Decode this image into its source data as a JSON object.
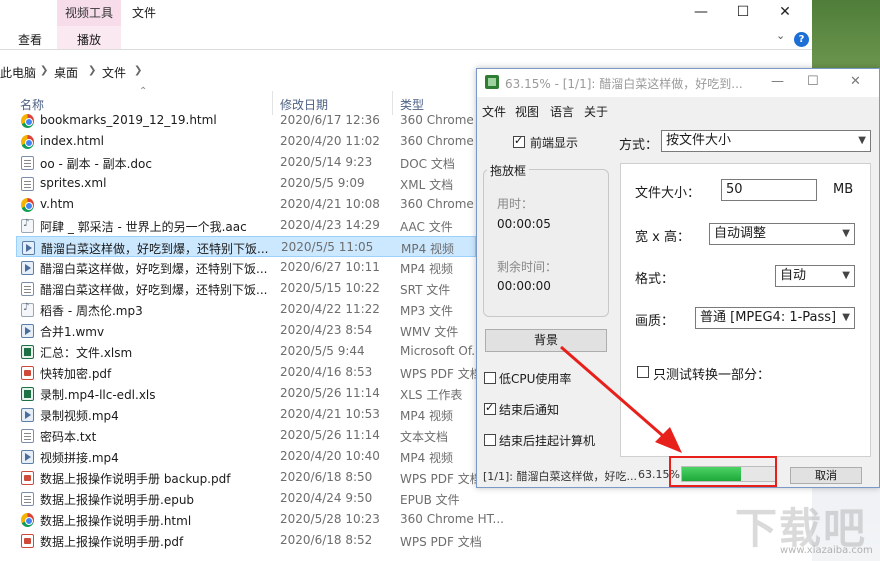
{
  "ribbon": {
    "context_tab": "视频工具",
    "file_tab": "文件",
    "view_tab": "查看",
    "play_tab": "播放"
  },
  "window_controls": {
    "minimize": "—",
    "maximize": "☐",
    "close": "✕"
  },
  "address": {
    "root": "此电脑",
    "desktop": "桌面",
    "folder": "文件"
  },
  "columns": {
    "name": "名称",
    "date": "修改日期",
    "type": "类型"
  },
  "files": [
    {
      "name": "bookmarks_2019_12_19.html",
      "date": "2020/6/17 12:36",
      "type": "360 Chrome HT...",
      "icon": "chrome"
    },
    {
      "name": "index.html",
      "date": "2020/4/20 11:02",
      "type": "360 Chrome HT...",
      "icon": "chrome"
    },
    {
      "name": "oo - 副本 - 副本.doc",
      "date": "2020/5/14 9:23",
      "type": "DOC 文档",
      "icon": "doc"
    },
    {
      "name": "sprites.xml",
      "date": "2020/5/5 9:09",
      "type": "XML 文档",
      "icon": "doc"
    },
    {
      "name": "v.htm",
      "date": "2020/4/21 10:08",
      "type": "360 Chrome HT...",
      "icon": "chrome"
    },
    {
      "name": "阿肆 _ 郭采洁 - 世界上的另一个我.aac",
      "date": "2020/4/23 14:29",
      "type": "AAC 文件",
      "icon": "audio"
    },
    {
      "name": "醋溜白菜这样做，好吃到爆，还特别下饭...",
      "date": "2020/5/5 11:05",
      "type": "MP4 视频",
      "icon": "video"
    },
    {
      "name": "醋溜白菜这样做，好吃到爆，还特别下饭...",
      "date": "2020/6/27 10:11",
      "type": "MP4 视频",
      "icon": "video"
    },
    {
      "name": "醋溜白菜这样做，好吃到爆，还特别下饭...",
      "date": "2020/5/15 10:22",
      "type": "SRT 文件",
      "icon": "doc"
    },
    {
      "name": "稻香 - 周杰伦.mp3",
      "date": "2020/4/22 11:22",
      "type": "MP3 文件",
      "icon": "audio"
    },
    {
      "name": "合并1.wmv",
      "date": "2020/4/23 8:54",
      "type": "WMV 文件",
      "icon": "video"
    },
    {
      "name": "汇总：文件.xlsm",
      "date": "2020/5/5 9:44",
      "type": "Microsoft Of...",
      "icon": "excel"
    },
    {
      "name": "快转加密.pdf",
      "date": "2020/4/16 8:53",
      "type": "WPS PDF 文档",
      "icon": "pdf"
    },
    {
      "name": "录制.mp4-llc-edl.xls",
      "date": "2020/5/26 11:14",
      "type": "XLS 工作表",
      "icon": "excel"
    },
    {
      "name": "录制视频.mp4",
      "date": "2020/4/21 10:53",
      "type": "MP4 视频",
      "icon": "video"
    },
    {
      "name": "密码本.txt",
      "date": "2020/5/26 11:14",
      "type": "文本文档",
      "icon": "doc"
    },
    {
      "name": "视频拼接.mp4",
      "date": "2020/4/20 10:40",
      "type": "MP4 视频",
      "icon": "video"
    },
    {
      "name": "数据上报操作说明手册 backup.pdf",
      "date": "2020/6/18 8:50",
      "type": "WPS PDF 文档",
      "icon": "pdf"
    },
    {
      "name": "数据上报操作说明手册.epub",
      "date": "2020/4/24 9:50",
      "type": "EPUB 文件",
      "icon": "doc"
    },
    {
      "name": "数据上报操作说明手册.html",
      "date": "2020/5/28 10:23",
      "type": "360 Chrome HT...",
      "icon": "chrome"
    },
    {
      "name": "数据上报操作说明手册.pdf",
      "date": "2020/6/18 8:52",
      "type": "WPS PDF 文档",
      "icon": "pdf"
    }
  ],
  "dialog": {
    "title": "63.15% - [1/1]: 醋溜白菜这样做，好吃到...",
    "menu": {
      "file": "文件",
      "view": "视图",
      "language": "语言",
      "about": "关于"
    },
    "front_display": "前端显示",
    "drop_box": "拖放框",
    "elapsed_label": "用时：",
    "elapsed_value": "00:00:05",
    "remaining_label": "剩余时间：",
    "remaining_value": "00:00:00",
    "background_button": "背景",
    "low_cpu": "低CPU使用率",
    "notify_done": "结束后通知",
    "hibernate_done": "结束后挂起计算机",
    "mode_label": "方式：",
    "mode_value": "按文件大小",
    "size_label": "文件大小：",
    "size_value": "50",
    "size_unit": "MB",
    "dims_label": "宽 x 高：",
    "dims_value": "自动调整",
    "format_label": "格式：",
    "format_value": "自动",
    "quality_label": "画质：",
    "quality_value": "普通  [MPEG4: 1-Pass]",
    "test_part": "只测试转换一部分：",
    "status_text": "[1/1]: 醋溜白菜这样做，好吃...",
    "status_percent": "63.15%",
    "progress": 0.6315,
    "cancel_button": "取消"
  },
  "watermark": {
    "text": "下载吧",
    "url": "www.xiazaiba.com"
  }
}
